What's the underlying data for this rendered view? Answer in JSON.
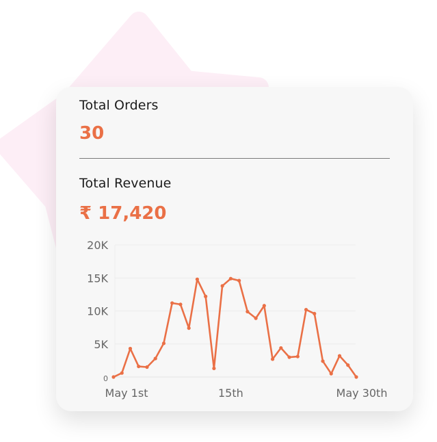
{
  "orders": {
    "label": "Total Orders",
    "value": "30"
  },
  "revenue": {
    "label": "Total Revenue",
    "value": "₹ 17,420"
  },
  "colors": {
    "accent": "#ea7046",
    "star": "#fdeef6"
  },
  "chart_data": {
    "type": "line",
    "title": "",
    "xlabel": "",
    "ylabel": "",
    "ylim": [
      0,
      20000
    ],
    "yticks": [
      0,
      5000,
      10000,
      15000,
      20000
    ],
    "ytick_labels": [
      "0",
      "5K",
      "10K",
      "15K",
      "20K"
    ],
    "xticks": [
      1,
      15,
      30
    ],
    "xtick_labels": [
      "May 1st",
      "15th",
      "May 30th"
    ],
    "grid": true,
    "legend": "none",
    "series": [
      {
        "x": [
          1,
          2,
          3,
          4,
          5,
          6,
          7,
          8,
          9,
          10,
          11,
          12,
          13,
          14,
          15,
          16,
          17,
          18,
          19,
          20,
          21,
          22,
          23,
          24,
          25,
          26,
          27,
          28,
          29,
          30
        ],
        "y": [
          0,
          600,
          4300,
          1600,
          1500,
          2800,
          5100,
          11200,
          11000,
          7400,
          14800,
          12200,
          1300,
          13800,
          14900,
          14600,
          9900,
          8900,
          10800,
          2700,
          4400,
          3000,
          3100,
          10200,
          9600,
          2400,
          500,
          3200,
          1800,
          0
        ]
      }
    ]
  }
}
